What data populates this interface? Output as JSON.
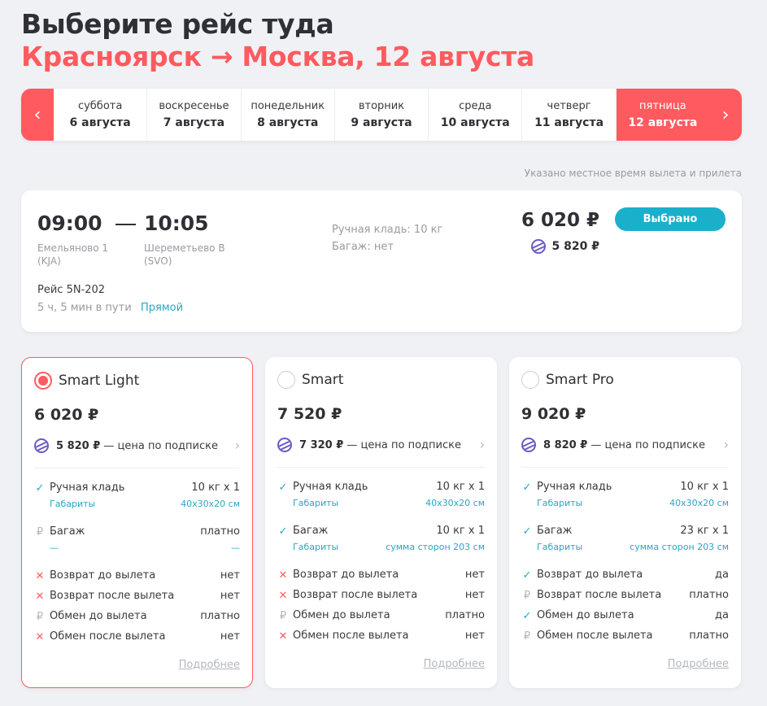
{
  "header": {
    "title": "Выберите рейс туда",
    "route": "Красноярск → Москва, 12 августа"
  },
  "datebar": {
    "prev_icon": "chevron-left",
    "next_icon": "chevron-right",
    "days": [
      {
        "weekday": "суббота",
        "date": "6 августа",
        "active": false
      },
      {
        "weekday": "воскресенье",
        "date": "7 августа",
        "active": false
      },
      {
        "weekday": "понедельник",
        "date": "8 августа",
        "active": false
      },
      {
        "weekday": "вторник",
        "date": "9 августа",
        "active": false
      },
      {
        "weekday": "среда",
        "date": "10 августа",
        "active": false
      },
      {
        "weekday": "четверг",
        "date": "11 августа",
        "active": false
      },
      {
        "weekday": "пятница",
        "date": "12 августа",
        "active": true
      }
    ]
  },
  "note": "Указано местное время вылета и прилета",
  "flight": {
    "dep_time": "09:00",
    "arr_time": "10:05",
    "dep_airport": "Емельяново 1",
    "dep_code": "(KJA)",
    "arr_airport": "Шереметьево B",
    "arr_code": "(SVO)",
    "flight_no": "Рейс 5N-202",
    "duration": "5 ч, 5 мин в пути",
    "direct": "Прямой",
    "hand_luggage": "Ручная кладь: 10 кг",
    "baggage": "Багаж: нет",
    "price": "6 020 ₽",
    "sub_price": "5 820 ₽",
    "button": "Выбрано"
  },
  "tariffs": [
    {
      "name": "Smart Light",
      "selected": true,
      "price": "6 020 ₽",
      "sub_price": "5 820 ₽",
      "sub_text": " — цена по подписке",
      "hand": {
        "label": "Ручная кладь",
        "value": "10 кг х 1",
        "sub_label": "Габариты",
        "sub_value": "40х30х20 см",
        "status": "ok"
      },
      "bag": {
        "label": "Багаж",
        "value": "платно",
        "sub_label": "—",
        "sub_value": "—",
        "status": "paid"
      },
      "rows": [
        {
          "label": "Возврат до вылета",
          "value": "нет",
          "status": "no"
        },
        {
          "label": "Возврат после вылета",
          "value": "нет",
          "status": "no"
        },
        {
          "label": "Обмен до вылета",
          "value": "платно",
          "status": "paid"
        },
        {
          "label": "Обмен после вылета",
          "value": "нет",
          "status": "no"
        }
      ],
      "more": "Подробнее"
    },
    {
      "name": "Smart",
      "selected": false,
      "price": "7 520 ₽",
      "sub_price": "7 320 ₽",
      "sub_text": " — цена по подписке",
      "hand": {
        "label": "Ручная кладь",
        "value": "10 кг х 1",
        "sub_label": "Габариты",
        "sub_value": "40х30х20 см",
        "status": "ok"
      },
      "bag": {
        "label": "Багаж",
        "value": "10 кг х 1",
        "sub_label": "Габариты",
        "sub_value": "сумма сторон 203 см",
        "status": "ok"
      },
      "rows": [
        {
          "label": "Возврат до вылета",
          "value": "нет",
          "status": "no"
        },
        {
          "label": "Возврат после вылета",
          "value": "нет",
          "status": "no"
        },
        {
          "label": "Обмен до вылета",
          "value": "платно",
          "status": "paid"
        },
        {
          "label": "Обмен после вылета",
          "value": "нет",
          "status": "no"
        }
      ],
      "more": "Подробнее"
    },
    {
      "name": "Smart Pro",
      "selected": false,
      "price": "9 020 ₽",
      "sub_price": "8 820 ₽",
      "sub_text": " — цена по подписке",
      "hand": {
        "label": "Ручная кладь",
        "value": "10 кг х 1",
        "sub_label": "Габариты",
        "sub_value": "40х30х20 см",
        "status": "ok"
      },
      "bag": {
        "label": "Багаж",
        "value": "23 кг х 1",
        "sub_label": "Габариты",
        "sub_value": "сумма сторон 203 см",
        "status": "ok"
      },
      "rows": [
        {
          "label": "Возврат до вылета",
          "value": "да",
          "status": "ok"
        },
        {
          "label": "Возврат после вылета",
          "value": "платно",
          "status": "paid"
        },
        {
          "label": "Обмен до вылета",
          "value": "да",
          "status": "ok"
        },
        {
          "label": "Обмен после вылета",
          "value": "платно",
          "status": "paid"
        }
      ],
      "more": "Подробнее"
    }
  ],
  "colors": {
    "accent": "#ff5a5f",
    "teal": "#1ab0cc",
    "link": "#2aa5c4"
  }
}
